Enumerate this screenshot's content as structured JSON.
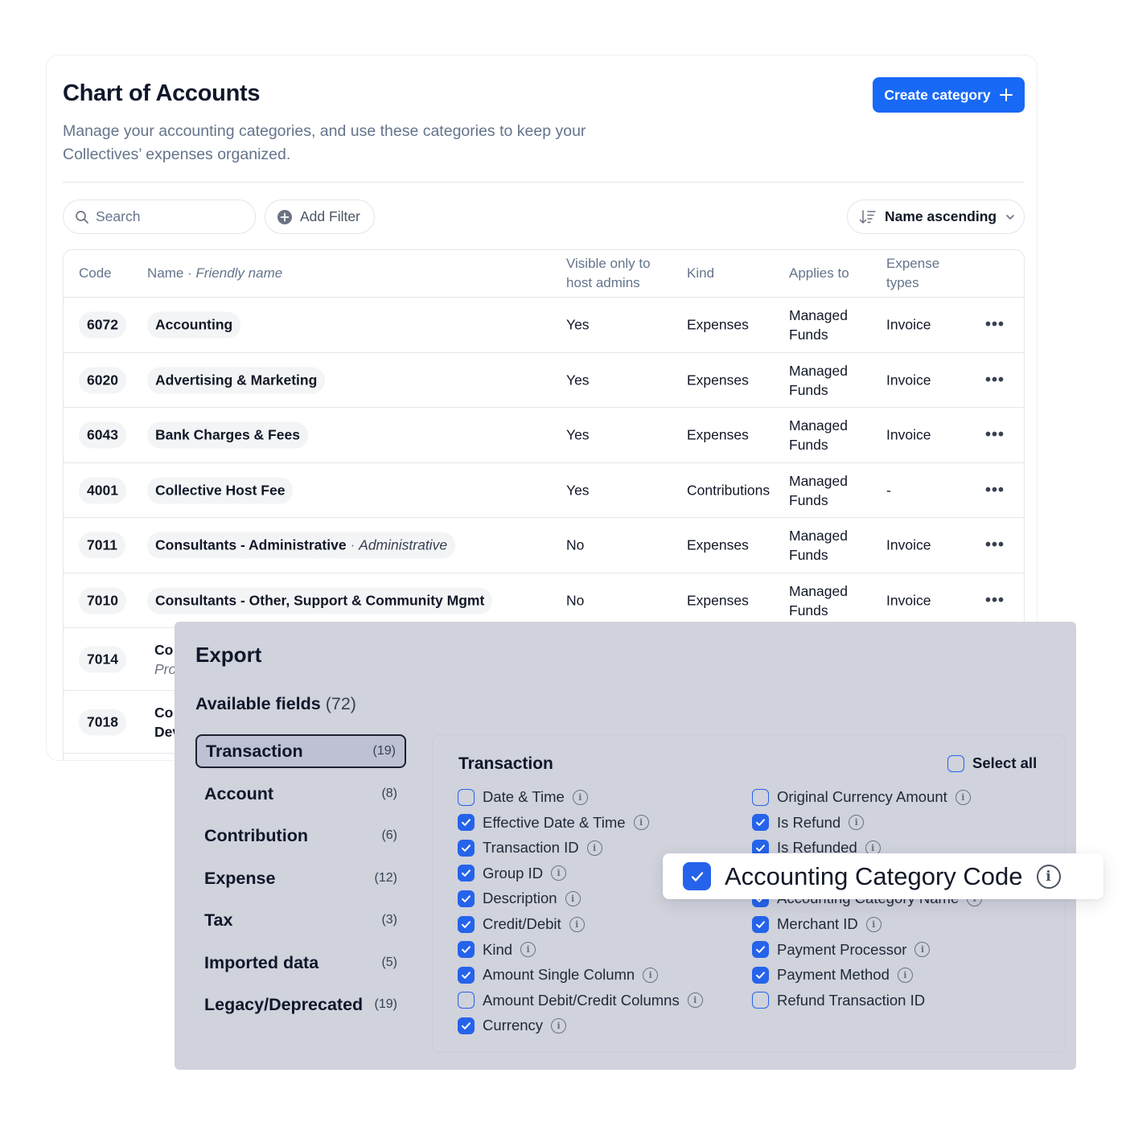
{
  "header": {
    "title": "Chart of Accounts",
    "subtitle": "Manage your accounting categories, and use these categories to keep your Collectives’ expenses organized.",
    "create_label": "Create category"
  },
  "toolbar": {
    "search_placeholder": "Search",
    "add_filter_label": "Add Filter",
    "sort_label": "Name ascending"
  },
  "table": {
    "columns": {
      "code": "Code",
      "name": "Name",
      "friendly": "Friendly name",
      "visible": "Visible only to host admins",
      "kind": "Kind",
      "applies": "Applies to",
      "expense_types": "Expense types"
    },
    "rows": [
      {
        "code": "6072",
        "name": "Accounting",
        "friendly": "",
        "visible": "Yes",
        "kind": "Expenses",
        "applies": "Managed Funds",
        "types": "Invoice"
      },
      {
        "code": "6020",
        "name": "Advertising & Marketing",
        "friendly": "",
        "visible": "Yes",
        "kind": "Expenses",
        "applies": "Managed Funds",
        "types": "Invoice"
      },
      {
        "code": "6043",
        "name": "Bank Charges & Fees",
        "friendly": "",
        "visible": "Yes",
        "kind": "Expenses",
        "applies": "Managed Funds",
        "types": "Invoice"
      },
      {
        "code": "4001",
        "name": "Collective Host Fee",
        "friendly": "",
        "visible": "Yes",
        "kind": "Contributions",
        "applies": "Managed Funds",
        "types": "-"
      },
      {
        "code": "7011",
        "name": "Consultants - Administrative",
        "friendly": "Administrative",
        "visible": "No",
        "kind": "Expenses",
        "applies": "Managed Funds",
        "types": "Invoice"
      },
      {
        "code": "7010",
        "name": "Consultants - Other, Support & Community Mgmt",
        "friendly": "",
        "visible": "No",
        "kind": "Expenses",
        "applies": "Managed Funds",
        "types": "Invoice"
      },
      {
        "code": "7014",
        "name_line1": "Co",
        "name_line2": "Pro"
      },
      {
        "code": "7018",
        "name_line1": "Co",
        "name_line2": "Dev"
      }
    ],
    "more_glyph": "•••"
  },
  "export": {
    "title": "Export",
    "available_label": "Available fields",
    "available_count": "(72)",
    "categories": [
      {
        "label": "Transaction",
        "count": "(19)"
      },
      {
        "label": "Account",
        "count": "(8)"
      },
      {
        "label": "Contribution",
        "count": "(6)"
      },
      {
        "label": "Expense",
        "count": "(12)"
      },
      {
        "label": "Tax",
        "count": "(3)"
      },
      {
        "label": "Imported data",
        "count": "(5)"
      },
      {
        "label": "Legacy/Deprecated",
        "count": "(19)"
      }
    ],
    "panel_title": "Transaction",
    "select_all_label": "Select all",
    "left_fields": [
      {
        "label": "Date & Time",
        "checked": false
      },
      {
        "label": "Effective Date & Time",
        "checked": true
      },
      {
        "label": "Transaction ID",
        "checked": true
      },
      {
        "label": "Group ID",
        "checked": true
      },
      {
        "label": "Description",
        "checked": true
      },
      {
        "label": "Credit/Debit",
        "checked": true
      },
      {
        "label": "Kind",
        "checked": true
      },
      {
        "label": "Amount Single Column",
        "checked": true
      },
      {
        "label": "Amount Debit/Credit Columns",
        "checked": false
      },
      {
        "label": "Currency",
        "checked": true
      }
    ],
    "right_fields": [
      {
        "label": "Original Currency Amount",
        "checked": false
      },
      {
        "label": "Is Refund",
        "checked": true
      },
      {
        "label": "Is Refunded",
        "checked": true
      },
      {
        "label": "Accounting Category Name",
        "checked": true
      },
      {
        "label": "Merchant ID",
        "checked": true
      },
      {
        "label": "Payment Processor",
        "checked": true
      },
      {
        "label": "Payment Method",
        "checked": true
      },
      {
        "label": "Refund Transaction ID",
        "checked": false
      }
    ],
    "highlight": {
      "label": "Accounting Category Code",
      "checked": true
    }
  },
  "colors": {
    "accent": "#1869f5",
    "checkbox": "#2563eb",
    "overlay_bg": "#d0d2dc"
  },
  "icons": {
    "search": "search-icon",
    "add_filter": "plus-circle-icon",
    "sort": "sort-descending-icon",
    "chevron": "chevron-down-icon",
    "info": "info-icon",
    "plus": "plus-icon",
    "more": "more-horizontal-icon"
  }
}
